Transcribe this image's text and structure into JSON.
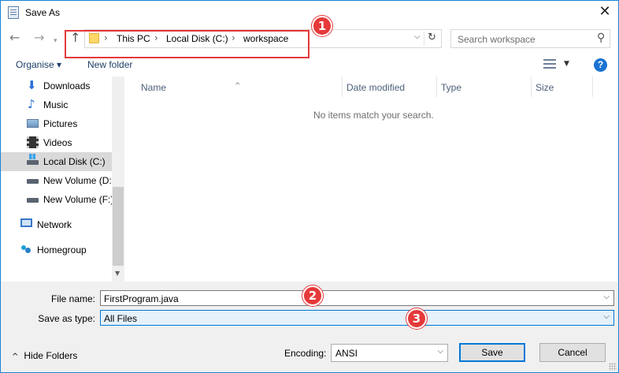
{
  "window": {
    "title": "Save As",
    "close_glyph": "✕"
  },
  "nav": {
    "back_glyph": "←",
    "forward_glyph": "→",
    "recent_glyph": "▾",
    "up_glyph": "↑"
  },
  "address": {
    "crumbs": [
      "This PC",
      "Local Disk (C:)",
      "workspace"
    ],
    "separator": "›",
    "dropdown_glyph": "⌵",
    "refresh_glyph": "↻"
  },
  "search": {
    "placeholder": "Search workspace",
    "icon_glyph": "⚲"
  },
  "toolbar": {
    "organise_label": "Organise ▾",
    "new_folder_label": "New folder",
    "view_dropdown_glyph": "▼",
    "help_label": "?"
  },
  "sidebar": {
    "items": [
      {
        "label": "Downloads",
        "icon": "download-icon"
      },
      {
        "label": "Music",
        "icon": "music-icon"
      },
      {
        "label": "Pictures",
        "icon": "pictures-icon"
      },
      {
        "label": "Videos",
        "icon": "videos-icon"
      },
      {
        "label": "Local Disk (C:)",
        "icon": "drive-icon",
        "selected": true
      },
      {
        "label": "New Volume (D:",
        "icon": "drive-icon"
      },
      {
        "label": "New Volume (F:)",
        "icon": "drive-icon"
      },
      {
        "label": "Network",
        "icon": "network-icon"
      },
      {
        "label": "Homegroup",
        "icon": "homegroup-icon"
      }
    ],
    "download_glyph": "⬇",
    "music_glyph": "♪"
  },
  "file_list": {
    "columns": [
      "Name",
      "Date modified",
      "Type",
      "Size"
    ],
    "sort_glyph": "^",
    "empty_message": "No items match your search."
  },
  "form": {
    "file_name_label": "File name:",
    "file_name_value": "FirstProgram.java",
    "save_type_label": "Save as type:",
    "save_type_value": "All Files",
    "chevron_glyph": "⌵"
  },
  "footer": {
    "hide_folders_label": "Hide Folders",
    "hide_folders_glyph": "^",
    "encoding_label": "Encoding:",
    "encoding_value": "ANSI",
    "save_label": "Save",
    "cancel_label": "Cancel"
  },
  "annotations": [
    "1",
    "2",
    "3"
  ],
  "colors": {
    "annotation_red": "#e5393a",
    "accent_blue": "#0078d7",
    "selected_gray": "#d9d9d9"
  }
}
